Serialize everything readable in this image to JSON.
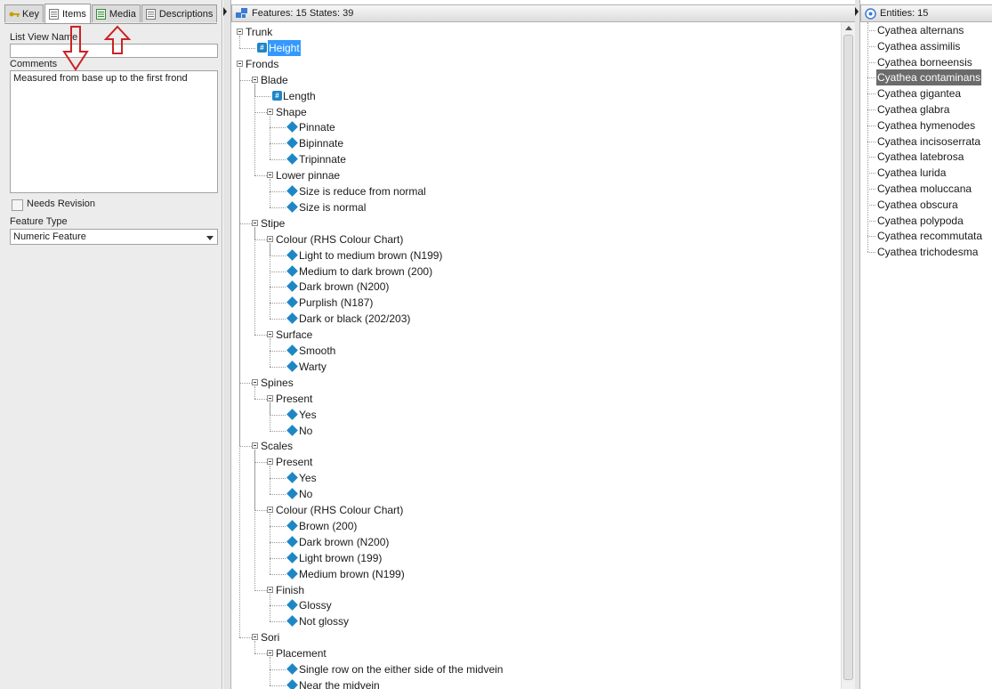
{
  "left_panel": {
    "tabs": [
      {
        "label": "Key",
        "icon": "key-icon"
      },
      {
        "label": "Items",
        "icon": "list-icon"
      },
      {
        "label": "Media",
        "icon": "media-icon"
      },
      {
        "label": "Descriptions",
        "icon": "document-icon"
      }
    ],
    "active_tab": "Items",
    "list_view_name_label": "List View Name",
    "list_view_name_value": "",
    "comments_label": "Comments",
    "comments_value": "Measured from base up to the first frond",
    "needs_revision_label": "Needs Revision",
    "needs_revision_checked": false,
    "feature_type_label": "Feature Type",
    "feature_type_value": "Numeric Feature",
    "annotation_color": "#cc2222"
  },
  "features_panel": {
    "header": "Features: 15 States: 39",
    "tree": [
      {
        "label": "Trunk",
        "level": 0,
        "kind": "group"
      },
      {
        "label": "Height",
        "level": 1,
        "kind": "numeric",
        "selected": true
      },
      {
        "label": "Fronds",
        "level": 0,
        "kind": "group"
      },
      {
        "label": "Blade",
        "level": 1,
        "kind": "group"
      },
      {
        "label": "Length",
        "level": 2,
        "kind": "numeric"
      },
      {
        "label": "Shape",
        "level": 2,
        "kind": "group"
      },
      {
        "label": "Pinnate",
        "level": 3,
        "kind": "state"
      },
      {
        "label": "Bipinnate",
        "level": 3,
        "kind": "state"
      },
      {
        "label": "Tripinnate",
        "level": 3,
        "kind": "state"
      },
      {
        "label": "Lower pinnae",
        "level": 2,
        "kind": "group"
      },
      {
        "label": "Size is reduce from normal",
        "level": 3,
        "kind": "state"
      },
      {
        "label": "Size is normal",
        "level": 3,
        "kind": "state"
      },
      {
        "label": "Stipe",
        "level": 1,
        "kind": "group"
      },
      {
        "label": "Colour (RHS Colour Chart)",
        "level": 2,
        "kind": "group"
      },
      {
        "label": "Light to medium brown (N199)",
        "level": 3,
        "kind": "state"
      },
      {
        "label": "Medium to dark brown (200)",
        "level": 3,
        "kind": "state"
      },
      {
        "label": "Dark brown (N200)",
        "level": 3,
        "kind": "state"
      },
      {
        "label": "Purplish (N187)",
        "level": 3,
        "kind": "state"
      },
      {
        "label": "Dark or black (202/203)",
        "level": 3,
        "kind": "state"
      },
      {
        "label": "Surface",
        "level": 2,
        "kind": "group"
      },
      {
        "label": "Smooth",
        "level": 3,
        "kind": "state"
      },
      {
        "label": "Warty",
        "level": 3,
        "kind": "state"
      },
      {
        "label": "Spines",
        "level": 1,
        "kind": "group"
      },
      {
        "label": "Present",
        "level": 2,
        "kind": "group"
      },
      {
        "label": "Yes",
        "level": 3,
        "kind": "state"
      },
      {
        "label": "No",
        "level": 3,
        "kind": "state"
      },
      {
        "label": "Scales",
        "level": 1,
        "kind": "group"
      },
      {
        "label": "Present",
        "level": 2,
        "kind": "group"
      },
      {
        "label": "Yes",
        "level": 3,
        "kind": "state"
      },
      {
        "label": "No",
        "level": 3,
        "kind": "state"
      },
      {
        "label": "Colour (RHS Colour Chart)",
        "level": 2,
        "kind": "group"
      },
      {
        "label": "Brown (200)",
        "level": 3,
        "kind": "state"
      },
      {
        "label": "Dark brown (N200)",
        "level": 3,
        "kind": "state"
      },
      {
        "label": "Light brown (199)",
        "level": 3,
        "kind": "state"
      },
      {
        "label": "Medium brown (N199)",
        "level": 3,
        "kind": "state"
      },
      {
        "label": "Finish",
        "level": 2,
        "kind": "group"
      },
      {
        "label": "Glossy",
        "level": 3,
        "kind": "state"
      },
      {
        "label": "Not glossy",
        "level": 3,
        "kind": "state"
      },
      {
        "label": "Sori",
        "level": 1,
        "kind": "group"
      },
      {
        "label": "Placement",
        "level": 2,
        "kind": "group"
      },
      {
        "label": "Single row on the either side of the midvein",
        "level": 3,
        "kind": "state"
      },
      {
        "label": "Near the midvein",
        "level": 3,
        "kind": "state"
      }
    ]
  },
  "entities_panel": {
    "header": "Entities: 15",
    "items": [
      {
        "label": "Cyathea alternans"
      },
      {
        "label": "Cyathea assimilis"
      },
      {
        "label": "Cyathea borneensis"
      },
      {
        "label": "Cyathea contaminans",
        "selected": true
      },
      {
        "label": "Cyathea gigantea"
      },
      {
        "label": "Cyathea glabra"
      },
      {
        "label": "Cyathea hymenodes"
      },
      {
        "label": "Cyathea incisoserrata"
      },
      {
        "label": "Cyathea latebrosa"
      },
      {
        "label": "Cyathea lurida"
      },
      {
        "label": "Cyathea moluccana"
      },
      {
        "label": "Cyathea obscura"
      },
      {
        "label": "Cyathea polypoda"
      },
      {
        "label": "Cyathea recommutata"
      },
      {
        "label": "Cyathea trichodesma"
      }
    ]
  }
}
